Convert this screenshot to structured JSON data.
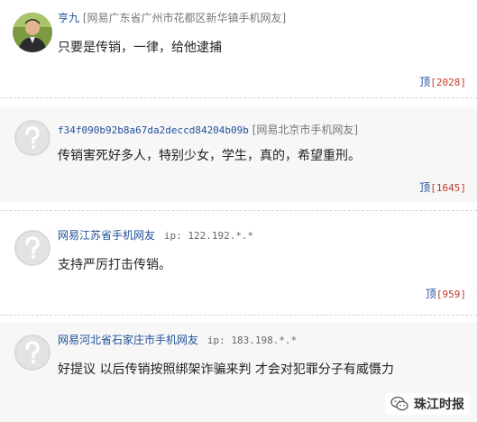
{
  "comments": [
    {
      "user": "亨九",
      "location": "[网易广东省广州市花都区新华镇手机网友]",
      "ip": "",
      "text": "只要是传销，一律，给他逮捕",
      "vote_label": "顶",
      "vote_count": "[2028]",
      "avatar": "photo"
    },
    {
      "user": "f34f090b92b8a67da2deccd84204b09b",
      "location": "[网易北京市手机网友]",
      "ip": "",
      "text": "传销害死好多人，特别少女，学生，真的，希望重刑。",
      "vote_label": "顶",
      "vote_count": "[1645]",
      "avatar": "default"
    },
    {
      "user": "网易江苏省手机网友",
      "location": "",
      "ip": "ip: 122.192.*.*",
      "text": "支持严厉打击传销。",
      "vote_label": "顶",
      "vote_count": "[959]",
      "avatar": "default"
    },
    {
      "user": "网易河北省石家庄市手机网友",
      "location": "",
      "ip": "ip: 183.198.*.*",
      "text": "好提议 以后传销按照绑架诈骗来判 才会对犯罪分子有威慑力",
      "vote_label": "",
      "vote_count": "",
      "avatar": "default"
    }
  ],
  "watermark": {
    "label": "珠江时报",
    "icon": "wechat-icon"
  },
  "colors": {
    "user_link": "#1f4f9a",
    "vote_count": "#c0392b",
    "alt_background": "#f7f7f7"
  }
}
